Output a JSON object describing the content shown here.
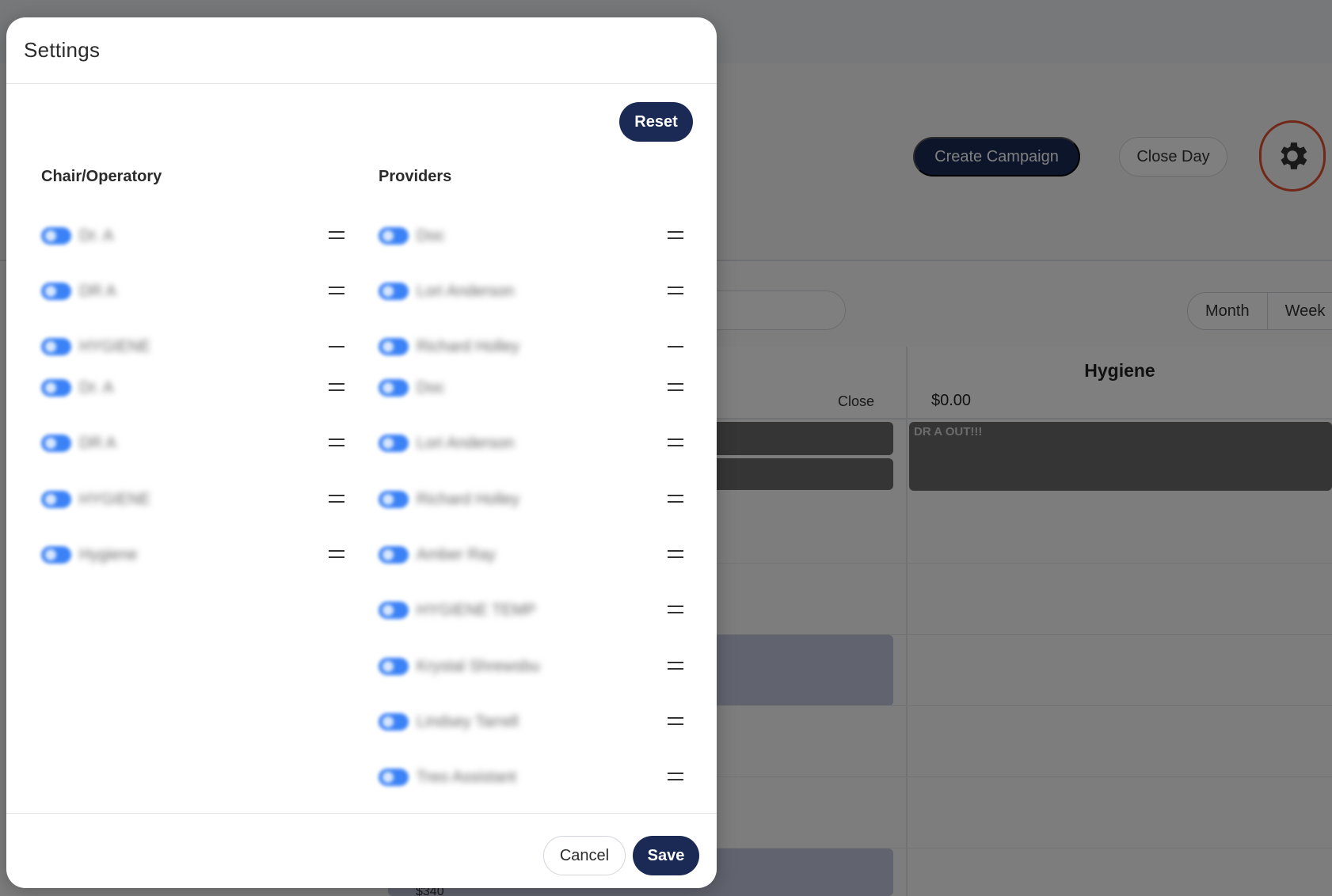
{
  "background": {
    "create_campaign_label": "Create Campaign",
    "close_day_label": "Close Day",
    "settings_icon": "gear-icon",
    "view_toggle": [
      "Month",
      "Week"
    ],
    "column_title": "Hygiene",
    "column_amount": "$0.00",
    "close_link": "Close",
    "appointment_label": "DR A OUT!!!",
    "bottom_amount": "$340",
    "highlight_color": "#e5502e"
  },
  "modal": {
    "title": "Settings",
    "reset_label": "Reset",
    "chair_heading": "Chair/Operatory",
    "providers_heading": "Providers",
    "chairs": [
      "Dr. A",
      "DR A",
      "HYGIENE",
      "Dr. A",
      "DR A",
      "HYGIENE",
      "Hygiene"
    ],
    "providers": [
      "Doc",
      "Lori Anderson",
      "Richard Holley",
      "Doc",
      "Lori Anderson",
      "Richard Holley",
      "Amber Ray",
      "HYGIENE TEMP",
      "Krystal Shrewsbu",
      "Lindsey Tarrell",
      "Treo Assistant"
    ],
    "cancel_label": "Cancel",
    "save_label": "Save",
    "toggle_color": "#3b82f6",
    "primary_color": "#1b2a55"
  }
}
